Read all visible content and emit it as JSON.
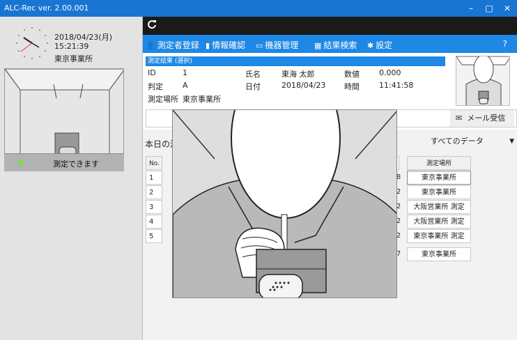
{
  "window": {
    "title": "ALC-Rec  ver. 2.00.001",
    "minimize": "–",
    "maximize": "□",
    "close": "✕"
  },
  "left": {
    "date": "2018/04/23(月)",
    "time": "15:21:39",
    "location": "東京事業所",
    "status": "測定できます",
    "status_color": "#7ed957"
  },
  "menu": [
    {
      "icon": "user-icon",
      "glyph": "👤",
      "label": "測定者登録"
    },
    {
      "icon": "book-icon",
      "glyph": "▮",
      "label": "情報確認"
    },
    {
      "icon": "device-icon",
      "glyph": "▭",
      "label": "機器管理"
    },
    {
      "icon": "calendar-icon",
      "glyph": "▦",
      "label": "結果検索"
    },
    {
      "icon": "gear-icon",
      "glyph": "✱",
      "label": "設定"
    }
  ],
  "help": "?",
  "result": {
    "header": "測定結果 (選択)",
    "labels": {
      "id": "ID",
      "name": "氏名",
      "value": "数値",
      "judge": "判定",
      "date": "日付",
      "time": "時間",
      "place": "測定場所"
    },
    "values": {
      "id": "1",
      "name": "東海 太郎",
      "value": "0.000",
      "judge": "A",
      "date": "2018/04/23",
      "time": "11:41:58",
      "place": "東京事業所"
    }
  },
  "mail_button": "メール受信",
  "list": {
    "title": "本日の測",
    "filter": "すべてのデータ",
    "col_no": "No.",
    "col_place": "測定場所",
    "rows": [
      {
        "no": "1",
        "frag": "8",
        "place": "東京事業所"
      },
      {
        "no": "2",
        "frag": "2",
        "place": "東京事業所"
      },
      {
        "no": "3",
        "frag": "2",
        "place": "大阪営業所 測定"
      },
      {
        "no": "4",
        "frag": "2",
        "place": "大阪営業所 測定"
      },
      {
        "no": "5",
        "frag": "2",
        "place": "東京事業所 測定"
      },
      {
        "no": "",
        "frag": "7",
        "place": "東京事業所"
      }
    ]
  },
  "colors": {
    "titlebar": "#1875d1",
    "menubar": "#1e88e5",
    "refreshbar": "#1a1a1a",
    "status_ok": "#7ed957"
  }
}
